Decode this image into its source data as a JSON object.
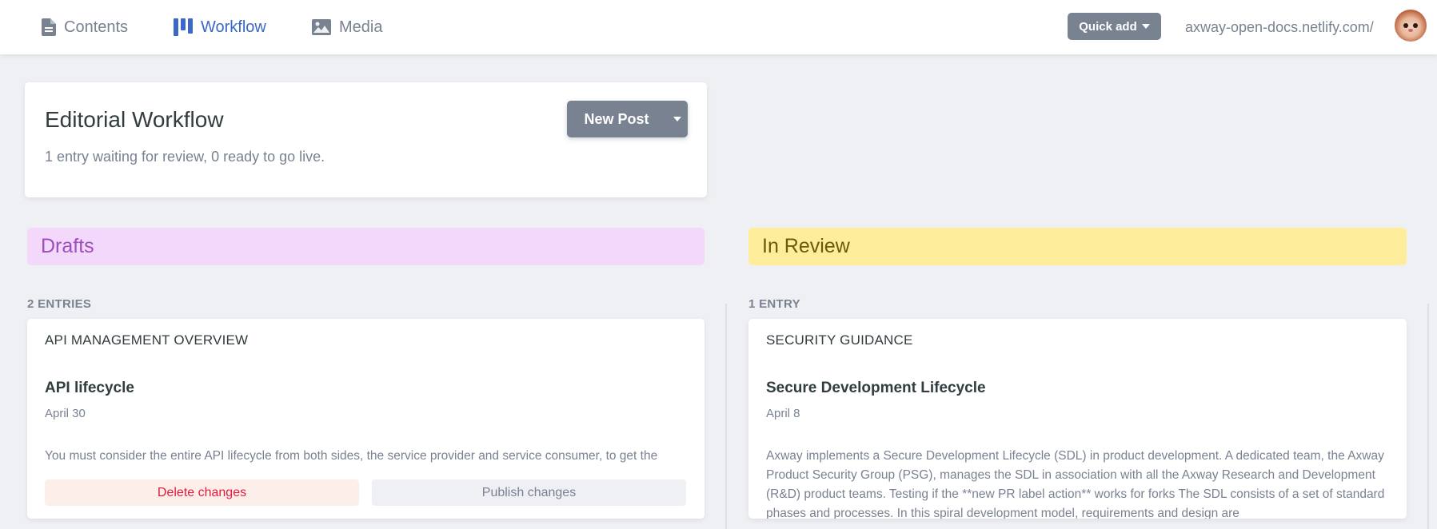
{
  "topbar": {
    "tabs": [
      {
        "label": "Contents",
        "icon": "document-icon",
        "active": false
      },
      {
        "label": "Workflow",
        "icon": "workflow-icon",
        "active": true
      },
      {
        "label": "Media",
        "icon": "image-icon",
        "active": false
      }
    ],
    "quick_add_label": "Quick add",
    "site_url": "axway-open-docs.netlify.com/",
    "avatar": "user-avatar"
  },
  "header": {
    "title": "Editorial Workflow",
    "subtitle": "1 entry waiting for review, 0 ready to go live.",
    "new_post_label": "New Post"
  },
  "columns": {
    "drafts": {
      "title": "Drafts",
      "count": "2 ENTRIES",
      "card": {
        "collection": "API MANAGEMENT OVERVIEW",
        "title": "API lifecycle",
        "date": "April 30",
        "body": "You must consider the entire API lifecycle from both sides, the service provider and service consumer, to get the",
        "delete_label": "Delete changes",
        "publish_label": "Publish changes"
      }
    },
    "review": {
      "title": "In Review",
      "count": "1 ENTRY",
      "card": {
        "collection": "SECURITY GUIDANCE",
        "title": "Secure Development Lifecycle",
        "date": "April 8",
        "body": "Axway implements a Secure Development Lifecycle (SDL) in product development. A dedicated team, the Axway Product Security Group (PSG), manages the SDL in association with all the Axway Research and Development (R&D) product teams. Testing if the **new PR label action** works for forks The SDL consists of a set of standard phases and processes. In this spiral development model, requirements and design are"
      }
    }
  },
  "colors": {
    "accent": "#3a69c7",
    "drafts_bg": "#f3d8fc",
    "drafts_text": "#9b4fb8",
    "review_bg": "#feee9c",
    "review_text": "#6b5a0c",
    "delete_text": "#e6193c",
    "delete_bg": "#fcefea"
  }
}
